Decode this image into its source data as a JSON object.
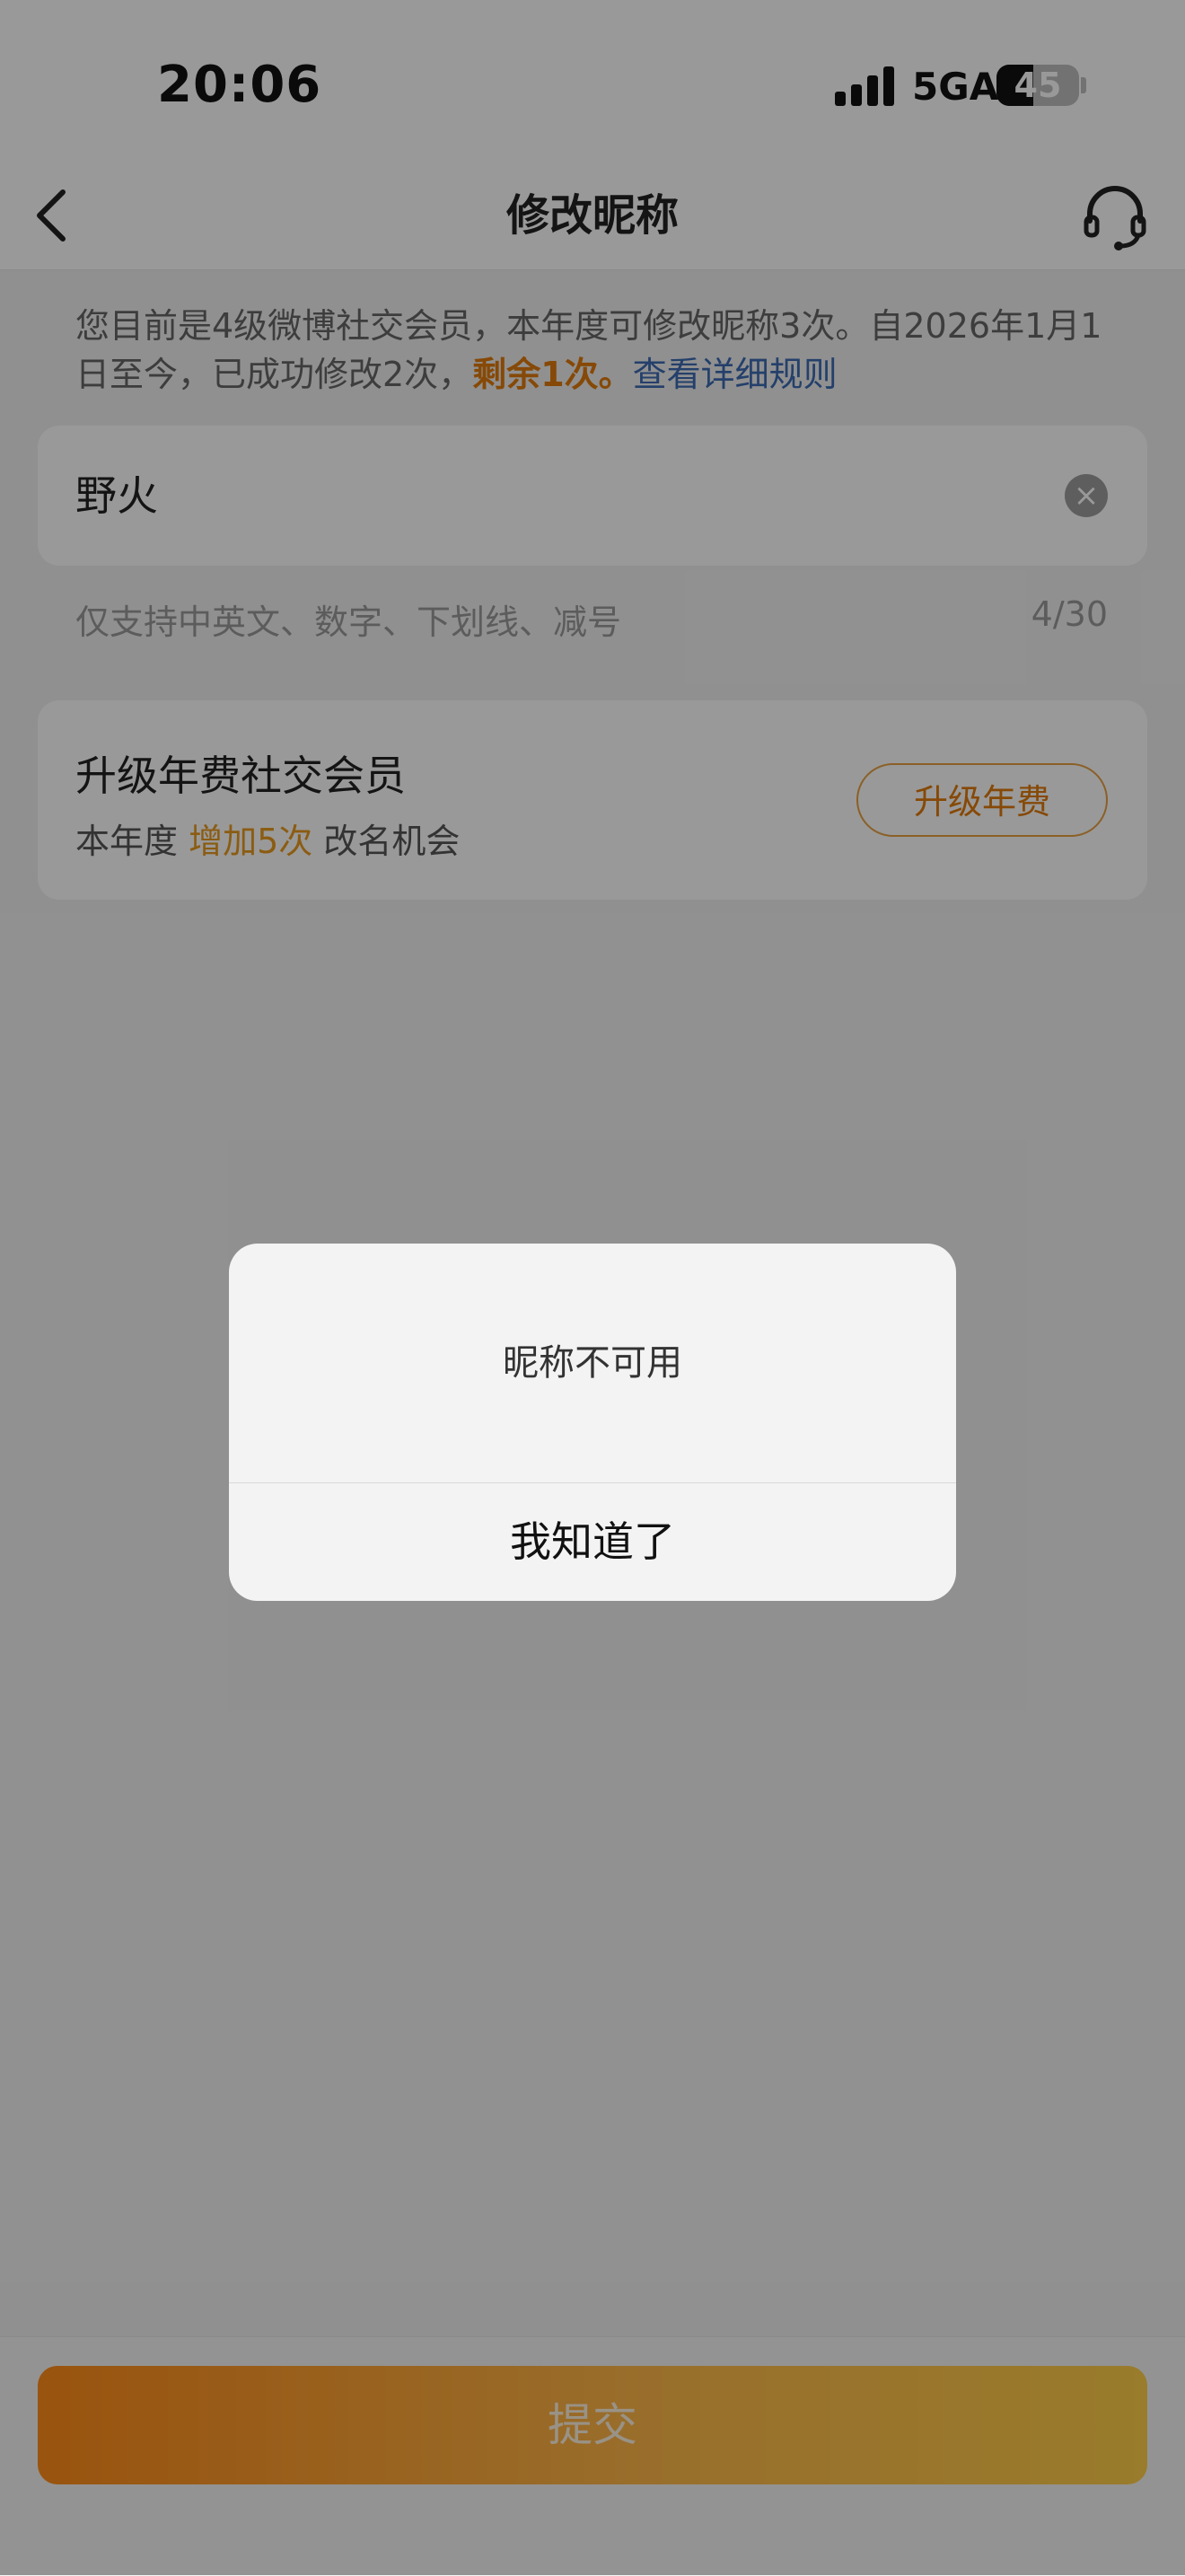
{
  "status_bar": {
    "time": "20:06",
    "network": "5GA",
    "battery": "45"
  },
  "nav": {
    "title": "修改昵称",
    "back_icon": "chevron-left-icon",
    "support_icon": "headset-icon"
  },
  "notice": {
    "text": "您目前是4级微博社交会员，本年度可修改昵称3次。自2026年1月1日至今，已成功修改2次，",
    "highlight": "剩余1次。",
    "link": "查看详细规则"
  },
  "name_input": {
    "value": "野火"
  },
  "hint": {
    "text": "仅支持中英文、数字、下划线、减号",
    "counter": "4/30"
  },
  "upgrade": {
    "title": "升级年费社交会员",
    "desc_prefix": "本年度 ",
    "desc_highlight": "增加5次",
    "desc_suffix": " 改名机会",
    "button": "升级年费"
  },
  "submit": {
    "label": "提交"
  },
  "dialog": {
    "message": "昵称不可用",
    "button": "我知道了"
  },
  "colors": {
    "accent": "#e07b0c",
    "link": "#3d6bb3",
    "submit_start": "#ff8c1a",
    "submit_end": "#ffcf4a"
  }
}
